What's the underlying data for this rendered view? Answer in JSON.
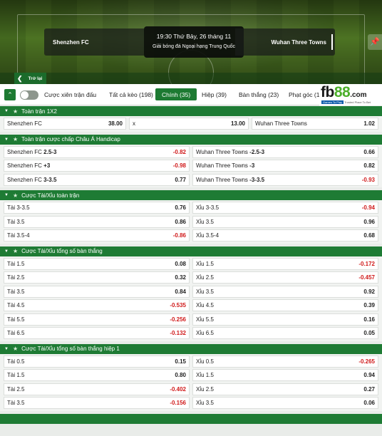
{
  "hero": {
    "home_team": "Shenzhen FC",
    "away_team": "Wuhan Three Towns",
    "datetime": "19:30 Thứ Bảy, 26 tháng 11",
    "league": "Giải bóng đá Ngoại hạng Trung Quốc",
    "back_label": "Trở lại"
  },
  "tabs": {
    "toggle_label": "Cược xiên trận đấu",
    "items": [
      {
        "label": "Tất cả kèo (198)"
      },
      {
        "label": "Chính (35)"
      },
      {
        "label": "Hiệp (39)"
      },
      {
        "label": "Bàn thắng (23)"
      },
      {
        "label": "Phạt góc (11"
      }
    ],
    "active_index": 1
  },
  "logo": {
    "fb": "fb",
    "num": "88",
    "com": ".com",
    "tag_left": "Games To Play",
    "tag_right": "Trusted Place To Bet"
  },
  "markets": {
    "m1x2": {
      "title": "Toàn trận 1X2",
      "row": [
        {
          "label": "Shenzhen FC",
          "odd": "38.00"
        },
        {
          "label": "x",
          "odd": "13.00"
        },
        {
          "label": "Wuhan Three Towns",
          "odd": "1.02"
        }
      ]
    },
    "handicap": {
      "title": "Toàn trận cược chấp Châu Á Handicap",
      "rows": [
        {
          "l_name": "Shenzhen FC",
          "l_line": "2.5-3",
          "l_odd": "-0.82",
          "r_name": "Wuhan Three Towns",
          "r_line": "-2.5-3",
          "r_odd": "0.66"
        },
        {
          "l_name": "Shenzhen FC",
          "l_line": "+3",
          "l_odd": "-0.98",
          "r_name": "Wuhan Three Towns",
          "r_line": "-3",
          "r_odd": "0.82"
        },
        {
          "l_name": "Shenzhen FC",
          "l_line": "3-3.5",
          "l_odd": "0.77",
          "r_name": "Wuhan Three Towns",
          "r_line": "-3-3.5",
          "r_odd": "-0.93"
        }
      ]
    },
    "ou_full": {
      "title": "Cược Tài/Xỉu toàn trận",
      "rows": [
        {
          "l": "Tài 3-3.5",
          "lo": "0.76",
          "r": "Xỉu 3-3.5",
          "ro": "-0.94"
        },
        {
          "l": "Tài 3.5",
          "lo": "0.86",
          "r": "Xỉu 3.5",
          "ro": "0.96"
        },
        {
          "l": "Tài 3.5-4",
          "lo": "-0.86",
          "r": "Xỉu 3.5-4",
          "ro": "0.68"
        }
      ]
    },
    "ou_goals": {
      "title": "Cược Tài/Xỉu tổng số bàn thắng",
      "rows": [
        {
          "l": "Tài 1.5",
          "lo": "0.08",
          "r": "Xỉu 1.5",
          "ro": "-0.172"
        },
        {
          "l": "Tài 2.5",
          "lo": "0.32",
          "r": "Xỉu 2.5",
          "ro": "-0.457"
        },
        {
          "l": "Tài 3.5",
          "lo": "0.84",
          "r": "Xỉu 3.5",
          "ro": "0.92"
        },
        {
          "l": "Tài 4.5",
          "lo": "-0.535",
          "r": "Xỉu 4.5",
          "ro": "0.39"
        },
        {
          "l": "Tài 5.5",
          "lo": "-0.256",
          "r": "Xỉu 5.5",
          "ro": "0.16"
        },
        {
          "l": "Tài 6.5",
          "lo": "-0.132",
          "r": "Xỉu 6.5",
          "ro": "0.05"
        }
      ]
    },
    "ou_half": {
      "title": "Cược Tài/Xỉu tổng số bàn thắng hiệp 1",
      "rows": [
        {
          "l": "Tài 0.5",
          "lo": "0.15",
          "r": "Xỉu 0.5",
          "ro": "-0.265"
        },
        {
          "l": "Tài 1.5",
          "lo": "0.80",
          "r": "Xỉu 1.5",
          "ro": "0.94"
        },
        {
          "l": "Tài 2.5",
          "lo": "-0.402",
          "r": "Xỉu 2.5",
          "ro": "0.27"
        },
        {
          "l": "Tài 3.5",
          "lo": "-0.156",
          "r": "Xỉu 3.5",
          "ro": "0.06"
        }
      ]
    }
  },
  "colors": {
    "brand_green": "#1e7b34",
    "negative_red": "#d01a1a"
  }
}
